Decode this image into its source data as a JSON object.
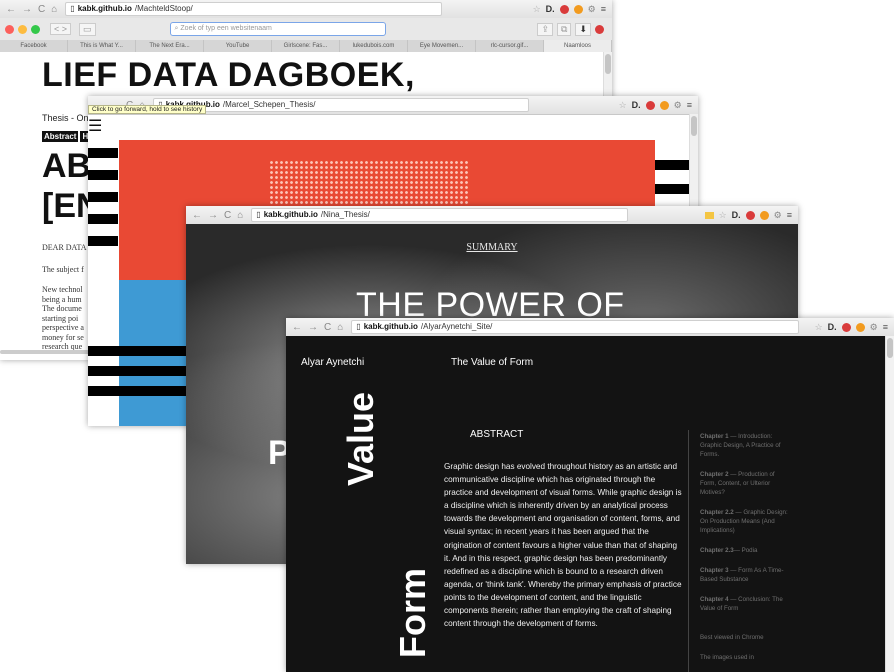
{
  "w1": {
    "url_host": "kabk.github.io",
    "url_path": "/MachteldStoop/",
    "search_placeholder": "Zoek of typ een websitenaam",
    "bookmarks": [
      "Facebook",
      "This is What Y...",
      "The Next Era...",
      "YouTube",
      "Girlscene: Fas...",
      "lukedubois.com",
      "Eye Movemen...",
      "rlc-cursor.gif...",
      "Naamloos"
    ],
    "heading": "LIEF DATA DAGBOEK,",
    "subtitle": "Thesis - Onli",
    "tag_abstract": "Abstract",
    "tag_h": "H",
    "big_line1": "AB",
    "big_line2": "[EN",
    "dear": "DEAR DATA",
    "subject": "The subject f",
    "para": [
      "New technol",
      "being a hum",
      "The docume",
      "starting poi",
      "perspective a",
      "money for se",
      "research que"
    ]
  },
  "w2": {
    "url_host": "kabk.github.io",
    "url_path": "/Marcel_Schepen_Thesis/",
    "tooltip": "Click to go forward, hold to see history"
  },
  "w3": {
    "url_host": "kabk.github.io",
    "url_path": "/Nina_Thesis/",
    "summary": "SUMMARY",
    "headline": "THE POWER OF",
    "big_letter": "P"
  },
  "w4": {
    "url_host": "kabk.github.io",
    "url_path": "/AlyarAynetchi_Site/",
    "author": "Alyar Aynetchi",
    "title": "The Value of Form",
    "abstract_heading": "ABSTRACT",
    "abstract_text": "Graphic design has evolved throughout history as an artistic and communicative discipline which has originated through the practice and development of visual forms. While graphic design is a discipline which is inherently driven by an analytical process towards the development and organisation of content, forms, and visual syntax; in recent years it has been argued that the origination of content favours a higher value than that of shaping it. And in this respect, graphic design has been predominantly redefined as a discipline which is bound to a research driven agenda, or 'think tank'. Whereby the primary emphasis of practice points to the development of content, and the linguistic components therein; rather than employing the craft of shaping content through the development of forms.",
    "vertical_word1": "Value",
    "vertical_word2": "Form",
    "chapters": [
      {
        "num": "Chapter 1",
        "title": " — Introduction: Graphic Design, A Practice of Forms."
      },
      {
        "num": "Chapter 2",
        "title": " — Production of Form, Content, or Ulterior Motives?"
      },
      {
        "num": "Chapter 2.2",
        "title": " — Graphic Design: On Production Means (And Implications)"
      },
      {
        "num": "Chapter 2.3",
        "title": "— Podia"
      },
      {
        "num": "Chapter 3",
        "title": " — Form As A Time-Based Substance"
      },
      {
        "num": "Chapter 4",
        "title": " — Conclusion: The Value of Form"
      }
    ],
    "footer1": "Best viewed in Chrome",
    "footer2": "The images used in"
  }
}
